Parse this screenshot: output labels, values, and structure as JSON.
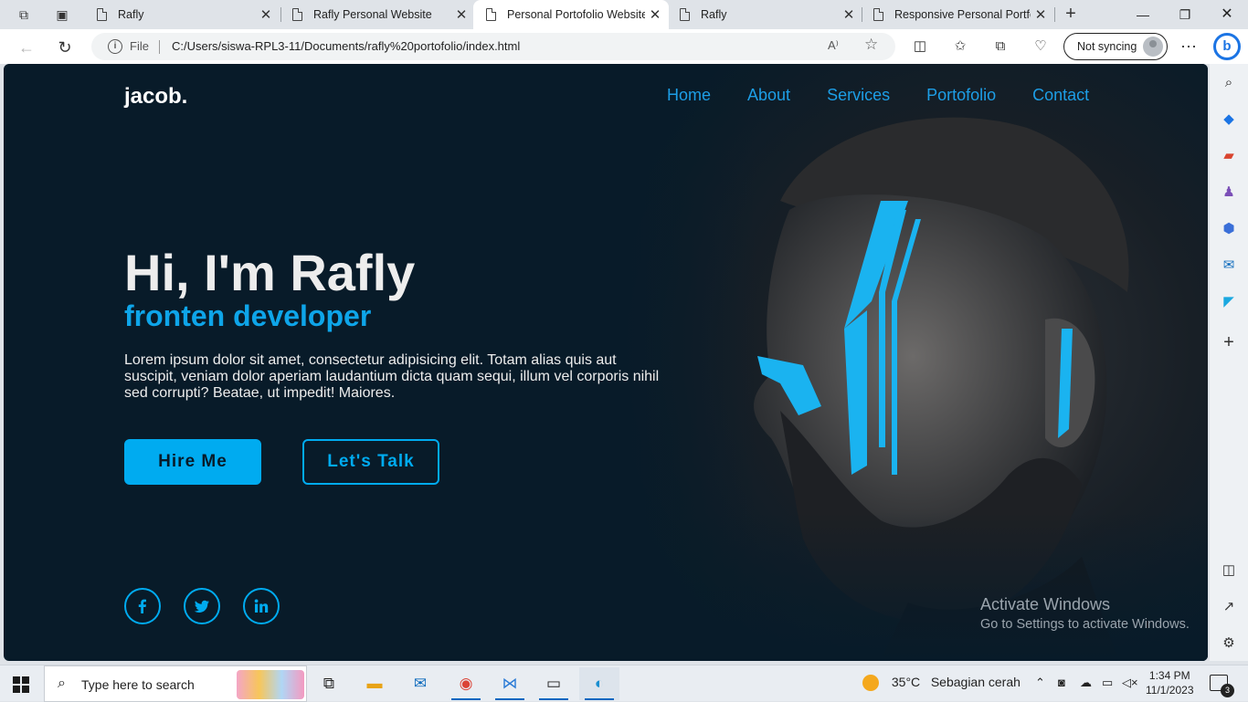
{
  "browser": {
    "tabs": [
      {
        "title": "Rafly",
        "active": false
      },
      {
        "title": "Rafly Personal Website",
        "active": false
      },
      {
        "title": "Personal Portofolio Website",
        "active": true
      },
      {
        "title": "Rafly",
        "active": false
      },
      {
        "title": "Responsive Personal Portfolio",
        "active": false
      }
    ],
    "address": {
      "scheme_label": "File",
      "url": "C:/Users/siswa-RPL3-11/Documents/rafly%20portofolio/index.html"
    },
    "profile": {
      "sync_label": "Not syncing"
    }
  },
  "page": {
    "logo": "jacob.",
    "nav": [
      "Home",
      "About",
      "Services",
      "Portofolio",
      "Contact"
    ],
    "hero": {
      "title": "Hi, I'm Rafly",
      "subtitle": "fronten developer",
      "description": "Lorem ipsum dolor sit amet, consectetur adipisicing elit. Totam alias quis aut suscipit, veniam dolor aperiam laudantium dicta quam sequi, illum vel corporis nihil sed corrupti? Beatae, ut impedit! Maiores."
    },
    "buttons": {
      "primary": "Hire Me",
      "secondary": "Let's Talk"
    },
    "social": [
      "facebook-icon",
      "twitter-icon",
      "linkedin-icon"
    ],
    "colors": {
      "background": "#081b29",
      "accent": "#00abf0",
      "nav_link": "#1d9ee6",
      "text": "#ededed"
    }
  },
  "os": {
    "activation": {
      "title": "Activate Windows",
      "subtitle": "Go to Settings to activate Windows."
    },
    "taskbar": {
      "search_placeholder": "Type here to search",
      "weather": {
        "temp": "35°C",
        "condition": "Sebagian cerah"
      },
      "time": "1:34 PM",
      "date": "11/1/2023",
      "notification_count": "3"
    }
  }
}
